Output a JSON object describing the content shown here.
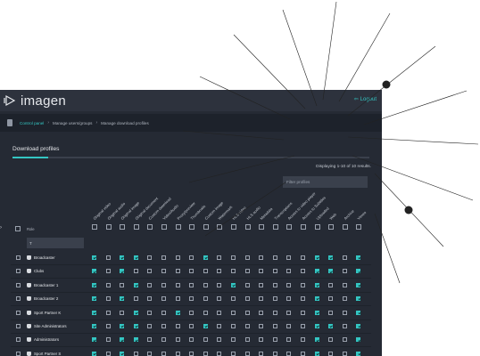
{
  "app": {
    "logo_text": "imagen",
    "logout_label": "Logout"
  },
  "breadcrumb": [
    "Control panel",
    "Manage users/groups",
    "Manage download profiles"
  ],
  "section": {
    "title": "Download profiles"
  },
  "results_text": "Displaying 1-10 of 10 results.",
  "filter_placeholder": "Filter profiles",
  "role": {
    "label": "Role",
    "filter_value": "T"
  },
  "columns": [
    "Original video",
    "Original audio",
    "Original image",
    "Original document",
    "Custom download",
    "Video/Audio",
    "Proxy/preview",
    "Thumbnails",
    "Custom image",
    "Watermark",
    "HLS video",
    "HLS audio",
    "Metadata",
    "Transcriptions",
    "Access to video player",
    "Access to Subtitles",
    "Uploaded",
    "Web",
    "Archive",
    "Vimeo"
  ],
  "rows": [
    {
      "name": "Broadcaster",
      "checks": [
        1,
        0,
        1,
        1,
        0,
        0,
        0,
        0,
        1,
        0,
        0,
        0,
        0,
        0,
        0,
        0,
        1,
        1,
        0,
        1
      ]
    },
    {
      "name": "Clubs",
      "checks": [
        1,
        0,
        1,
        0,
        0,
        0,
        0,
        0,
        0,
        0,
        0,
        0,
        0,
        0,
        0,
        0,
        1,
        1,
        0,
        1
      ]
    },
    {
      "name": "Broadcaster 1",
      "checks": [
        1,
        0,
        0,
        1,
        0,
        0,
        0,
        0,
        0,
        0,
        1,
        0,
        0,
        0,
        0,
        0,
        1,
        0,
        0,
        1
      ]
    },
    {
      "name": "Broadcaster 2",
      "checks": [
        1,
        0,
        1,
        0,
        0,
        0,
        0,
        0,
        0,
        0,
        0,
        0,
        0,
        0,
        0,
        0,
        1,
        0,
        0,
        1
      ]
    },
    {
      "name": "Sport Partner K",
      "checks": [
        1,
        0,
        0,
        1,
        0,
        0,
        1,
        0,
        0,
        0,
        0,
        0,
        0,
        0,
        0,
        0,
        1,
        0,
        0,
        1
      ]
    },
    {
      "name": "Site Administrators",
      "checks": [
        1,
        0,
        1,
        1,
        0,
        0,
        0,
        0,
        1,
        0,
        0,
        0,
        0,
        0,
        0,
        0,
        1,
        1,
        0,
        1
      ]
    },
    {
      "name": "Administrators",
      "checks": [
        1,
        0,
        1,
        1,
        0,
        0,
        0,
        0,
        0,
        0,
        0,
        0,
        0,
        0,
        0,
        0,
        1,
        0,
        0,
        1
      ]
    },
    {
      "name": "Sport Partner S",
      "checks": [
        1,
        0,
        1,
        0,
        0,
        0,
        0,
        0,
        0,
        0,
        0,
        0,
        0,
        0,
        0,
        0,
        1,
        0,
        0,
        1
      ]
    }
  ],
  "colors": {
    "accent": "#34c6c3",
    "background": "#252a34",
    "topbar": "#2d323d"
  }
}
